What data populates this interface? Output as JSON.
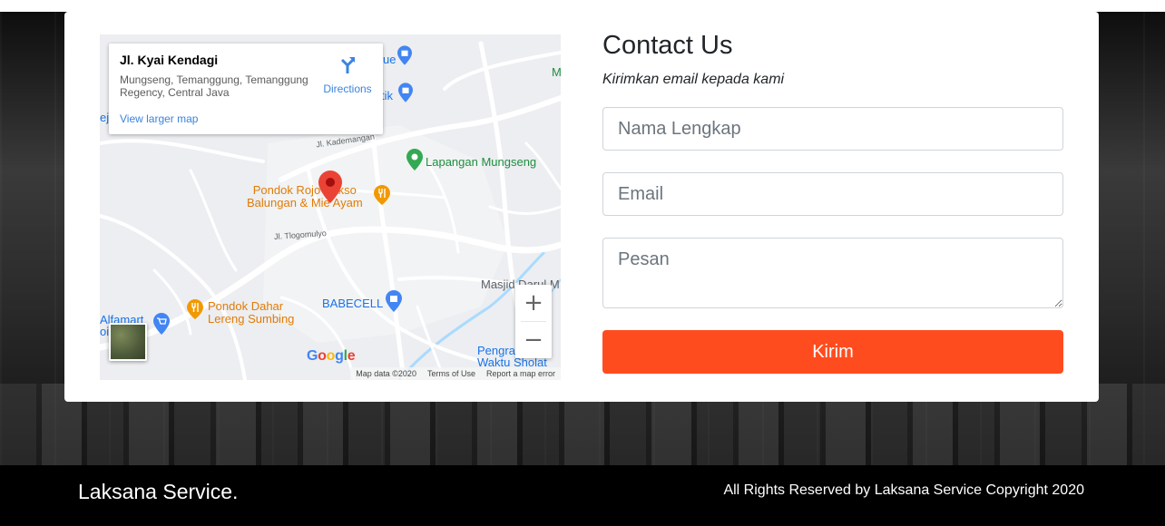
{
  "map": {
    "place_title": "Jl. Kyai Kendagi",
    "place_address": "Mungseng, Temanggung, Temanggung Regency, Central Java",
    "directions_label": "Directions",
    "view_larger_label": "View larger map",
    "poi_restaurant_1": "Pondok Rojo Bakso Balungan & Mie Ayam",
    "poi_restaurant_1_line1": "Pondok Rojo Bakso",
    "poi_restaurant_1_line2": "Balungan & Mie Ayam",
    "poi_park": "Lapangan Mungseng",
    "poi_restaurant_2_line1": "Pondok Dahar",
    "poi_restaurant_2_line2": "Lereng Sumbing",
    "poi_shop_babecell": "BABECELL",
    "poi_mosque": "Masjid Darul M",
    "poi_shop_alfamart": "Alfamart",
    "poi_prayer_line1": "Pengram",
    "poi_prayer_line2": "Waktu Sholat",
    "poi_fragment_ue": "ue",
    "poi_fragment_tik": "tik",
    "poi_fragment_m": "M",
    "poi_fragment_ej": "ej",
    "poi_fragment_oi": "oi",
    "road_kademangan": "Jl. Kademangan",
    "road_tlogomulyo": "Jl. Tlogomulyo",
    "zoom_in_label": "+",
    "zoom_out_label": "−",
    "google_logo": "Google",
    "map_data": "Map data ©2020",
    "terms": "Terms of Use",
    "report": "Report a map error",
    "icons": {
      "directions": "directions-icon",
      "pin": "location-pin-icon",
      "restaurant": "restaurant-icon",
      "park": "park-icon",
      "shop": "shopping-bag-icon",
      "cart": "shopping-cart-icon"
    }
  },
  "contact": {
    "title": "Contact Us",
    "subtitle": "Kirimkan email kepada kami",
    "name_placeholder": "Nama Lengkap",
    "email_placeholder": "Email",
    "message_placeholder": "Pesan",
    "submit_label": "Kirim"
  },
  "footer": {
    "brand": "Laksana Service.",
    "copyright": "All Rights Reserved by Laksana Service Copyright 2020"
  },
  "colors": {
    "accent": "#ff4c1f",
    "map_bg": "#e8eaed",
    "map_link": "#3a84df",
    "footer_bg": "#000000"
  }
}
